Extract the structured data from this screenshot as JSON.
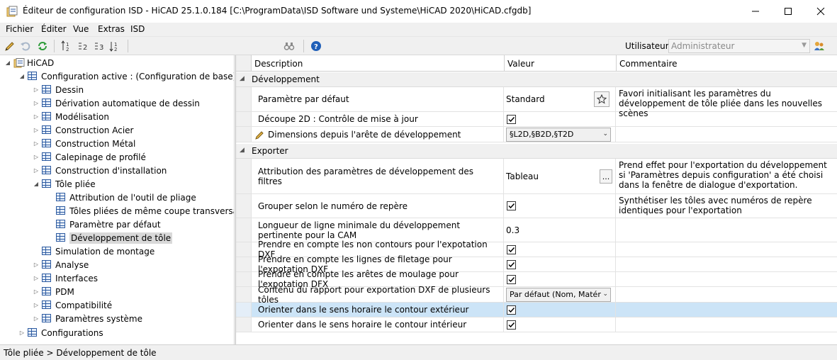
{
  "window": {
    "title": "Éditeur de configuration ISD  -  HiCAD 25.1.0.184 [C:\\ProgramData\\ISD Software und Systeme\\HiCAD 2020\\HiCAD.cfgdb]"
  },
  "menu": [
    "Fichier",
    "Éditer",
    "Vue",
    "Extras",
    "ISD"
  ],
  "toolbar": {
    "user_label": "Utilisateur",
    "user_value": "Administrateur"
  },
  "tree": {
    "root": "HiCAD",
    "active_config": "Configuration active : (Configuration de base)",
    "items": [
      "Dessin",
      "Dérivation automatique de dessin",
      "Modélisation",
      "Construction Acier",
      "Construction Métal",
      "Calepinage de profilé",
      "Construction d'installation",
      "Tôle pliée"
    ],
    "tole_children": [
      "Attribution de l'outil de pliage",
      "Tôles pliées de même coupe transversale",
      "Paramètre par défaut",
      "Développement de tôle"
    ],
    "items_after": [
      "Simulation de montage",
      "Analyse",
      "Interfaces",
      "PDM",
      "Compatibilité",
      "Paramètres système"
    ],
    "configurations": "Configurations"
  },
  "grid": {
    "headers": [
      "Description",
      "Valeur",
      "Commentaire"
    ],
    "cat_dev": "Développement",
    "cat_exp": "Exporter",
    "rows": [
      {
        "desc": "Paramètre par défaut",
        "value": "Standard",
        "comment": "Favori initialisant les paramètres du développement de tôle pliée dans les nouvelles scènes"
      },
      {
        "desc": "Découpe 2D : Contrôle de mise à jour",
        "value": "",
        "comment": ""
      },
      {
        "desc": "Dimensions depuis l'arête de développement",
        "value": "§L2D,§B2D,§T2D",
        "comment": ""
      },
      {
        "desc": "Attribution des paramètres de développement des filtres",
        "value": "Tableau",
        "comment": "Prend effet pour l'exportation du développement si 'Paramètres depuis configuration' a été choisi dans la fenêtre de dialogue d'exportation."
      },
      {
        "desc": "Grouper selon le numéro de repère",
        "value": "",
        "comment": "Synthétiser les tôles avec numéros de repère identiques pour l'exportation"
      },
      {
        "desc": "Longueur de ligne minimale du développement pertinente pour la CAM",
        "value": "0.3",
        "comment": ""
      },
      {
        "desc": "Prendre en compte les non contours pour l'expotation DXF",
        "value": "",
        "comment": ""
      },
      {
        "desc": "Prendre en compte les lignes de filetage pour l'expotation DXF",
        "value": "",
        "comment": ""
      },
      {
        "desc": "Prendre en compte les arêtes de moulage pour l'expotation DFX",
        "value": "",
        "comment": ""
      },
      {
        "desc": "Contenu du rapport pour exportation DXF de plusieurs tôles",
        "value": "Par défaut (Nom, Matér",
        "comment": ""
      },
      {
        "desc": "Orienter dans le sens horaire le contour extérieur",
        "value": "",
        "comment": ""
      },
      {
        "desc": "Orienter dans le sens horaire le contour intérieur",
        "value": "",
        "comment": ""
      }
    ]
  },
  "status": "Tôle pliée > Développement de tôle",
  "colors": {
    "highlight": "#cce4f7",
    "accent": "#2c5aa0"
  }
}
